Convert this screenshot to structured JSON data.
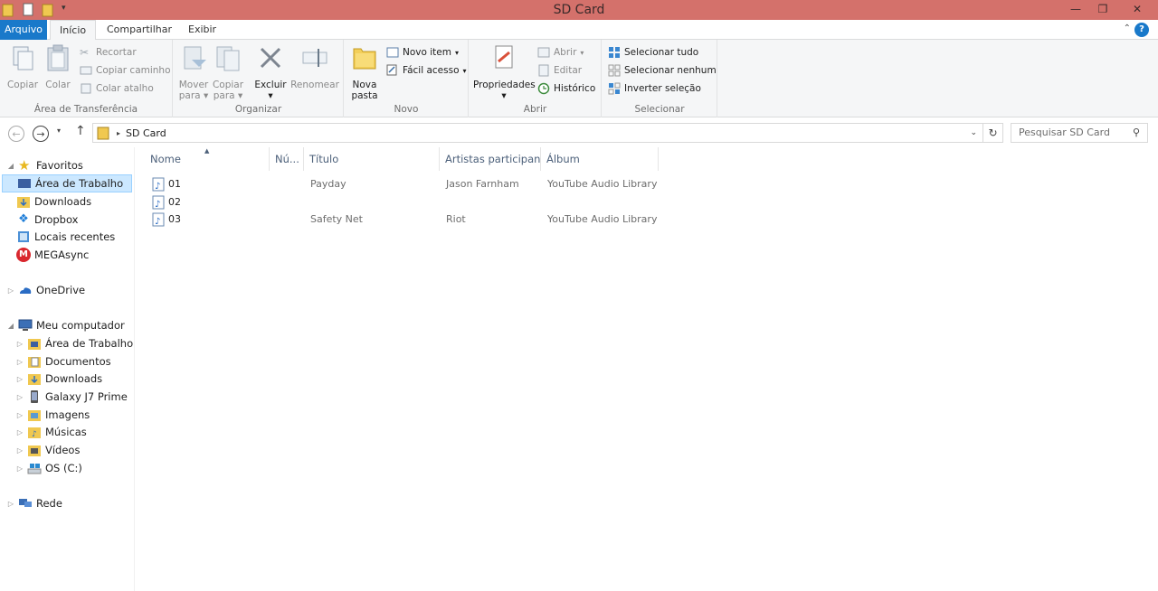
{
  "window": {
    "title": "SD Card"
  },
  "tabs": {
    "file": "Arquivo",
    "home": "Início",
    "share": "Compartilhar",
    "view": "Exibir"
  },
  "ribbon": {
    "clipboard": {
      "copy": "Copiar",
      "paste": "Colar",
      "cut": "Recortar",
      "copy_path": "Copiar caminho",
      "paste_shortcut": "Colar atalho",
      "label": "Área de Transferência"
    },
    "organize": {
      "move_to_1": "Mover",
      "move_to_2": "para",
      "copy_to_1": "Copiar",
      "copy_to_2": "para",
      "delete": "Excluir",
      "rename": "Renomear",
      "label": "Organizar"
    },
    "new": {
      "new_folder_1": "Nova",
      "new_folder_2": "pasta",
      "new_item": "Novo item",
      "easy_access": "Fácil acesso",
      "label": "Novo"
    },
    "open": {
      "properties": "Propriedades",
      "open": "Abrir",
      "edit": "Editar",
      "history": "Histórico",
      "label": "Abrir"
    },
    "select": {
      "select_all": "Selecionar tudo",
      "select_none": "Selecionar nenhum",
      "invert": "Inverter seleção",
      "label": "Selecionar"
    }
  },
  "address": {
    "path": "SD Card",
    "search_placeholder": "Pesquisar SD Card"
  },
  "nav": {
    "favorites": "Favoritos",
    "fav_items": [
      "Área de Trabalho",
      "Downloads",
      "Dropbox",
      "Locais recentes",
      "MEGAsync"
    ],
    "onedrive": "OneDrive",
    "computer": "Meu computador",
    "pc_items": [
      "Área de Trabalho",
      "Documentos",
      "Downloads",
      "Galaxy J7 Prime",
      "Imagens",
      "Músicas",
      "Vídeos",
      "OS (C:)"
    ],
    "network": "Rede"
  },
  "columns": {
    "name": "Nome",
    "num": "Nú...",
    "title": "Título",
    "artists": "Artistas participan...",
    "album": "Álbum"
  },
  "files": [
    {
      "name": "01",
      "title": "Payday",
      "artist": "Jason Farnham",
      "album": "YouTube Audio Library"
    },
    {
      "name": "02",
      "title": "",
      "artist": "",
      "album": ""
    },
    {
      "name": "03",
      "title": "Safety Net",
      "artist": "Riot",
      "album": "YouTube Audio Library"
    }
  ],
  "colors": {
    "titlebar": "#d4716b",
    "file_tab": "#1979ca",
    "selection": "#cce8ff"
  }
}
